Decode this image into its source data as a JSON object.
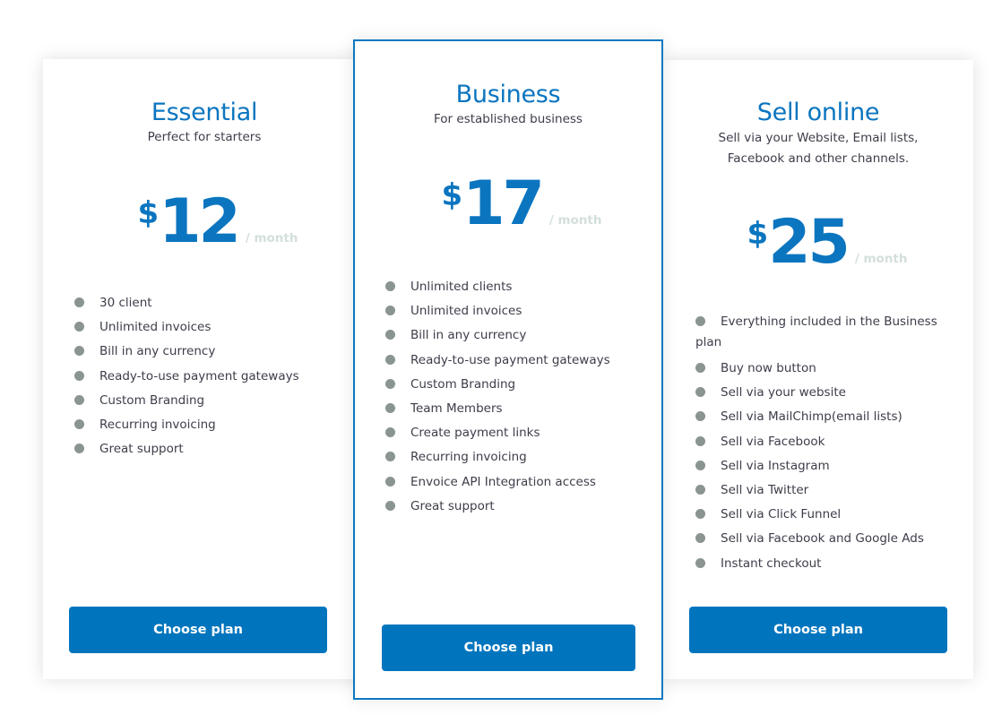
{
  "plans": [
    {
      "name": "Essential",
      "subtitle": "Perfect for starters",
      "currency": "$",
      "price": "12",
      "period": "/ month",
      "features": [
        "30 client",
        "Unlimited invoices",
        "Bill in any currency",
        "Ready-to-use payment gateways",
        "Custom Branding",
        "Recurring invoicing",
        "Great support"
      ],
      "button_label": "Choose plan",
      "highlighted": false
    },
    {
      "name": "Business",
      "subtitle": "For established business",
      "currency": "$",
      "price": "17",
      "period": "/ month",
      "features": [
        "Unlimited clients",
        "Unlimited invoices",
        "Bill in any currency",
        "Ready-to-use payment gateways",
        "Custom Branding",
        "Team Members",
        "Create payment links",
        "Recurring invoicing",
        "Envoice API Integration access",
        "Great support"
      ],
      "button_label": "Choose plan",
      "highlighted": true
    },
    {
      "name": "Sell online",
      "subtitle": "Sell via your Website, Email lists, Facebook and other channels.",
      "currency": "$",
      "price": "25",
      "period": "/ month",
      "features": [
        "Everything included in the Business plan",
        "Buy now button",
        "Sell via your website",
        "Sell via MailChimp(email lists)",
        "Sell via Facebook",
        "Sell via Instagram",
        "Sell via Twitter",
        "Sell via Click Funnel",
        "Sell via Facebook and Google Ads",
        "Instant checkout"
      ],
      "button_label": "Choose plan",
      "highlighted": false
    }
  ],
  "colors": {
    "accent": "#0b75bf",
    "button": "#0075bd",
    "period_text": "#d3dfdb",
    "bullet": "#8a9490",
    "body_text": "#3d3d4a"
  }
}
